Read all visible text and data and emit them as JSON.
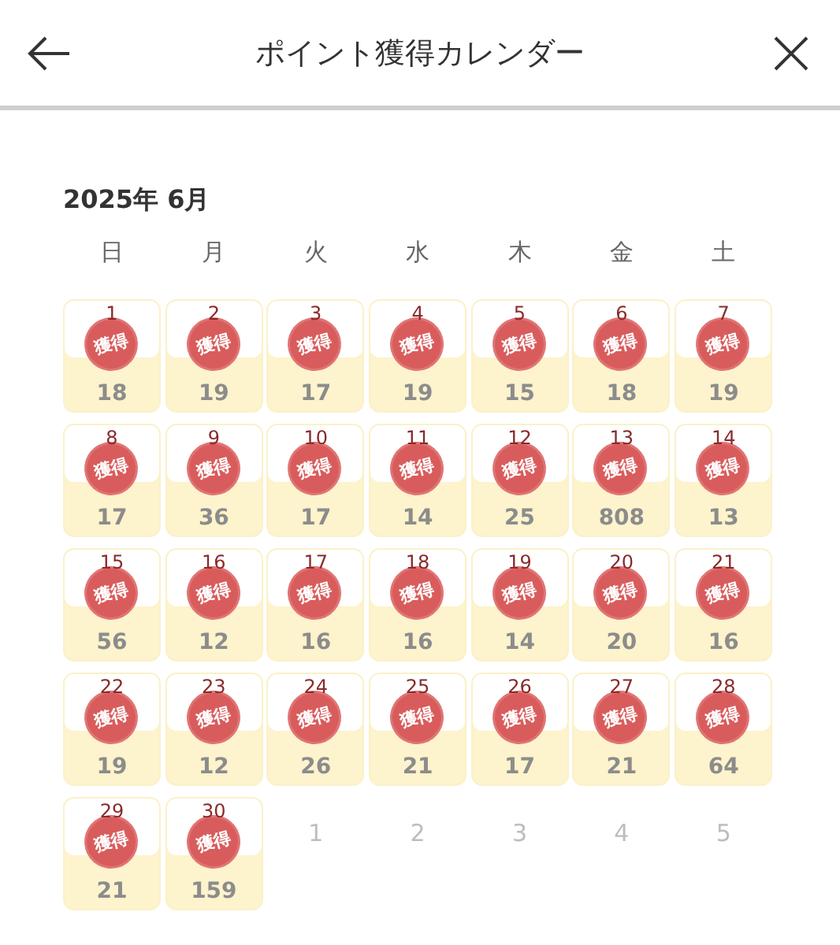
{
  "header": {
    "title": "ポイント獲得カレンダー"
  },
  "month": "2025年 6月",
  "weekdays": [
    "日",
    "月",
    "火",
    "水",
    "木",
    "金",
    "土"
  ],
  "days": [
    {
      "kind": "earned",
      "day": "1",
      "stamp": "獲得",
      "points": "18"
    },
    {
      "kind": "earned",
      "day": "2",
      "stamp": "獲得",
      "points": "19"
    },
    {
      "kind": "earned",
      "day": "3",
      "stamp": "獲得",
      "points": "17"
    },
    {
      "kind": "earned",
      "day": "4",
      "stamp": "獲得",
      "points": "19"
    },
    {
      "kind": "earned",
      "day": "5",
      "stamp": "獲得",
      "points": "15"
    },
    {
      "kind": "earned",
      "day": "6",
      "stamp": "獲得",
      "points": "18"
    },
    {
      "kind": "earned",
      "day": "7",
      "stamp": "獲得",
      "points": "19"
    },
    {
      "kind": "earned",
      "day": "8",
      "stamp": "獲得",
      "points": "17"
    },
    {
      "kind": "earned",
      "day": "9",
      "stamp": "獲得",
      "points": "36"
    },
    {
      "kind": "earned",
      "day": "10",
      "stamp": "獲得",
      "points": "17"
    },
    {
      "kind": "earned",
      "day": "11",
      "stamp": "獲得",
      "points": "14"
    },
    {
      "kind": "earned",
      "day": "12",
      "stamp": "獲得",
      "points": "25"
    },
    {
      "kind": "earned",
      "day": "13",
      "stamp": "獲得",
      "points": "808"
    },
    {
      "kind": "earned",
      "day": "14",
      "stamp": "獲得",
      "points": "13"
    },
    {
      "kind": "earned",
      "day": "15",
      "stamp": "獲得",
      "points": "56"
    },
    {
      "kind": "earned",
      "day": "16",
      "stamp": "獲得",
      "points": "12"
    },
    {
      "kind": "earned",
      "day": "17",
      "stamp": "獲得",
      "points": "16"
    },
    {
      "kind": "earned",
      "day": "18",
      "stamp": "獲得",
      "points": "16"
    },
    {
      "kind": "earned",
      "day": "19",
      "stamp": "獲得",
      "points": "14"
    },
    {
      "kind": "earned",
      "day": "20",
      "stamp": "獲得",
      "points": "20"
    },
    {
      "kind": "earned",
      "day": "21",
      "stamp": "獲得",
      "points": "16"
    },
    {
      "kind": "earned",
      "day": "22",
      "stamp": "獲得",
      "points": "19"
    },
    {
      "kind": "earned",
      "day": "23",
      "stamp": "獲得",
      "points": "12"
    },
    {
      "kind": "earned",
      "day": "24",
      "stamp": "獲得",
      "points": "26"
    },
    {
      "kind": "earned",
      "day": "25",
      "stamp": "獲得",
      "points": "21"
    },
    {
      "kind": "earned",
      "day": "26",
      "stamp": "獲得",
      "points": "17"
    },
    {
      "kind": "earned",
      "day": "27",
      "stamp": "獲得",
      "points": "21"
    },
    {
      "kind": "earned",
      "day": "28",
      "stamp": "獲得",
      "points": "64"
    },
    {
      "kind": "earned",
      "day": "29",
      "stamp": "獲得",
      "points": "21"
    },
    {
      "kind": "earned",
      "day": "30",
      "stamp": "獲得",
      "points": "159"
    },
    {
      "kind": "outside",
      "day": "1"
    },
    {
      "kind": "outside",
      "day": "2"
    },
    {
      "kind": "outside",
      "day": "3"
    },
    {
      "kind": "outside",
      "day": "4"
    },
    {
      "kind": "outside",
      "day": "5"
    }
  ]
}
